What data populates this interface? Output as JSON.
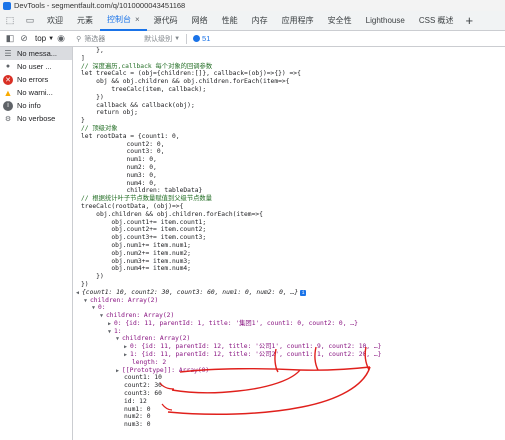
{
  "window": {
    "title": "DevTools - segmentfault.com/q/1010000043451168"
  },
  "tabs": [
    {
      "label": "欢迎"
    },
    {
      "label": "元素"
    },
    {
      "label": "控制台",
      "active": true
    },
    {
      "label": "源代码"
    },
    {
      "label": "网络"
    },
    {
      "label": "性能"
    },
    {
      "label": "内存"
    },
    {
      "label": "应用程序"
    },
    {
      "label": "安全性"
    },
    {
      "label": "Lighthouse"
    },
    {
      "label": "CSS 概述"
    }
  ],
  "toolbar": {
    "context": "top",
    "filter_placeholder": "筛选器",
    "levels": "默认级别",
    "issues_count": "51"
  },
  "sidebar": {
    "items": [
      {
        "label": "No messa...",
        "icon": "list-icon"
      },
      {
        "label": "No user ...",
        "icon": "user-icon"
      },
      {
        "label": "No errors",
        "icon": "error-icon"
      },
      {
        "label": "No warni...",
        "icon": "warning-icon"
      },
      {
        "label": "No info",
        "icon": "info-icon"
      },
      {
        "label": "No verbose",
        "icon": "verbose-icon"
      }
    ]
  },
  "code_lines": [
    "    },",
    "]",
    "// 深度遍历,callback 每个对象的回调参数",
    "let treeCalc = (obj={children:[]}, callback=(obj)=>{}) =>{",
    "    obj && obj.children && obj.children.forEach(item=>{",
    "        treeCalc(item, callback);",
    "    })",
    "    callback && callback(obj);",
    "    return obj;",
    "}",
    "// 顶级对象",
    "let rootData = {count1: 0,",
    "            count2: 0,",
    "            count3: 0,",
    "            num1: 0,",
    "            num2: 0,",
    "            num3: 0,",
    "            num4: 0,",
    "            children: tableData}",
    "// 根据统计叶子节点数量赋值到父级节点数量",
    "treeCalc(rootData, (obj)=>{",
    "    obj.children && obj.children.forEach(item=>{",
    "        obj.count1+= item.count1;",
    "        obj.count2+= item.count2;",
    "        obj.count3+= item.count3;",
    "        obj.num1+= item.num1;",
    "        obj.num2+= item.num2;",
    "        obj.num3+= item.num3;",
    "        obj.num4+= item.num4;",
    "    })",
    "})"
  ],
  "result_lines": [
    {
      "indent": 0,
      "arrow": "◀",
      "text": "{count1: 10, count2: 30, count3: 60, num1: 0, num2: 0, …}",
      "info": true,
      "italic": true
    },
    {
      "indent": 1,
      "arrow": "▼",
      "text": "children: Array(2)"
    },
    {
      "indent": 2,
      "arrow": "▼",
      "text": "0:"
    },
    {
      "indent": 3,
      "arrow": "▼",
      "text": "children: Array(2)"
    },
    {
      "indent": 4,
      "arrow": "▶",
      "text": "0: {id: 11, parentId: 1, title: '集团1', count1: 0, count2: 0, …}"
    },
    {
      "indent": 4,
      "arrow": "▼",
      "text": "1:"
    },
    {
      "indent": 5,
      "arrow": "▼",
      "text": "children: Array(2)"
    },
    {
      "indent": 6,
      "arrow": "▶",
      "text": "0: {id: 11, parentId: 12, title: '公司1', count1: 9, count2: 10, …}"
    },
    {
      "indent": 6,
      "arrow": "▶",
      "text": "1: {id: 11, parentId: 12, title: '公司2', count1: 1, count2: 20, …}"
    },
    {
      "indent": 6,
      "arrow": "",
      "text": "length: 2"
    },
    {
      "indent": 5,
      "arrow": "▶",
      "text": "[[Prototype]]: Array(0)"
    },
    {
      "indent": 5,
      "arrow": "",
      "text": "count1: 10"
    },
    {
      "indent": 5,
      "arrow": "",
      "text": "count2: 30"
    },
    {
      "indent": 5,
      "arrow": "",
      "text": "count3: 60"
    },
    {
      "indent": 5,
      "arrow": "",
      "text": "id: 12"
    },
    {
      "indent": 5,
      "arrow": "",
      "text": "num1: 0"
    },
    {
      "indent": 5,
      "arrow": "",
      "text": "num2: 0"
    },
    {
      "indent": 5,
      "arrow": "",
      "text": "num3: 0"
    }
  ]
}
